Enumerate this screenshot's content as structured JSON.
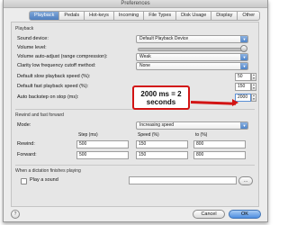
{
  "window": {
    "title": "Preferences"
  },
  "tabs": [
    {
      "label": "Playback",
      "active": true
    },
    {
      "label": "Pedals",
      "active": false
    },
    {
      "label": "Hot-keys",
      "active": false
    },
    {
      "label": "Incoming",
      "active": false
    },
    {
      "label": "File Types",
      "active": false
    },
    {
      "label": "Disk Usage",
      "active": false
    },
    {
      "label": "Display",
      "active": false
    },
    {
      "label": "Other",
      "active": false
    }
  ],
  "playback": {
    "section_title": "Playback",
    "sound_device": {
      "label": "Sound device:",
      "value": "Default Playback Device"
    },
    "volume_level": {
      "label": "Volume level:"
    },
    "auto_adjust": {
      "label": "Volume auto-adjust (range compression):",
      "value": "Weak"
    },
    "clarity": {
      "label": "Clarity low frequency cutoff method:",
      "value": "None"
    },
    "slow_speed": {
      "label": "Default slow playback speed (%):",
      "value": "50"
    },
    "fast_speed": {
      "label": "Default fast playback speed (%):",
      "value": "150"
    },
    "auto_backstep": {
      "label": "Auto backstep on stop (ms):",
      "value": "2000"
    }
  },
  "rewind": {
    "section_title": "Rewind and fast forward",
    "mode": {
      "label": "Mode:",
      "value": "Increasing speed"
    },
    "columns": {
      "step": "Step (ms)",
      "speed": "Speed (%)",
      "to": "to (%)"
    },
    "rows": [
      {
        "label": "Rewind:",
        "step": "500",
        "speed": "150",
        "to": "800"
      },
      {
        "label": "Forward:",
        "step": "500",
        "speed": "150",
        "to": "800"
      }
    ]
  },
  "finish": {
    "section_title": "When a dictation finishes playing",
    "play_sound": {
      "label": "Play a sound",
      "checked": false
    }
  },
  "footer": {
    "help": "?",
    "cancel": "Cancel",
    "ok": "OK"
  },
  "annotation": {
    "text": "2000 ms = 2 seconds",
    "color": "#d21414"
  },
  "accent": "#4f84c8"
}
